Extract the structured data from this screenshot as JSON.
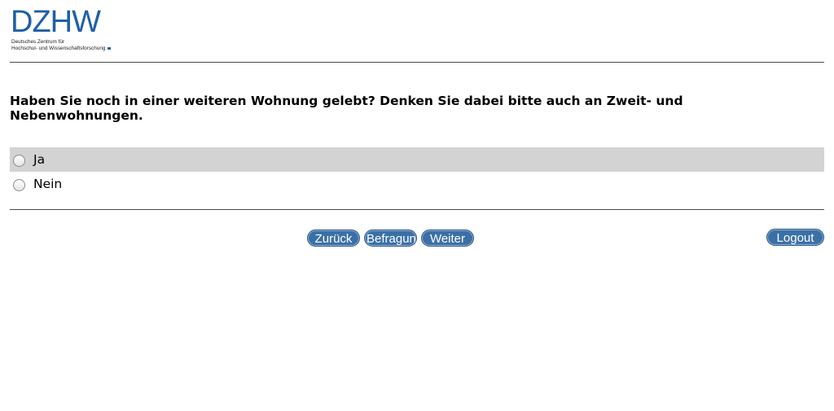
{
  "logo": {
    "wordmark": "DZHW",
    "line1": "Deutsches Zentrum für",
    "line2": "Hochschul- und Wissenschaftsforschung",
    "brand_color": "#1f5fa8"
  },
  "question": {
    "text": "Haben Sie noch in einer weiteren Wohnung gelebt? Denken Sie dabei bitte auch an Zweit- und Nebenwohnungen."
  },
  "options": [
    {
      "label": "Ja",
      "selected": false,
      "highlighted": true
    },
    {
      "label": "Nein",
      "selected": false,
      "highlighted": false
    }
  ],
  "navigation": {
    "back_label": "Zurück",
    "survey_label": "Befragung",
    "next_label": "Weiter",
    "logout_label": "Logout"
  },
  "colors": {
    "button": "#3b70a6",
    "highlight_row": "#d3d3d3"
  }
}
